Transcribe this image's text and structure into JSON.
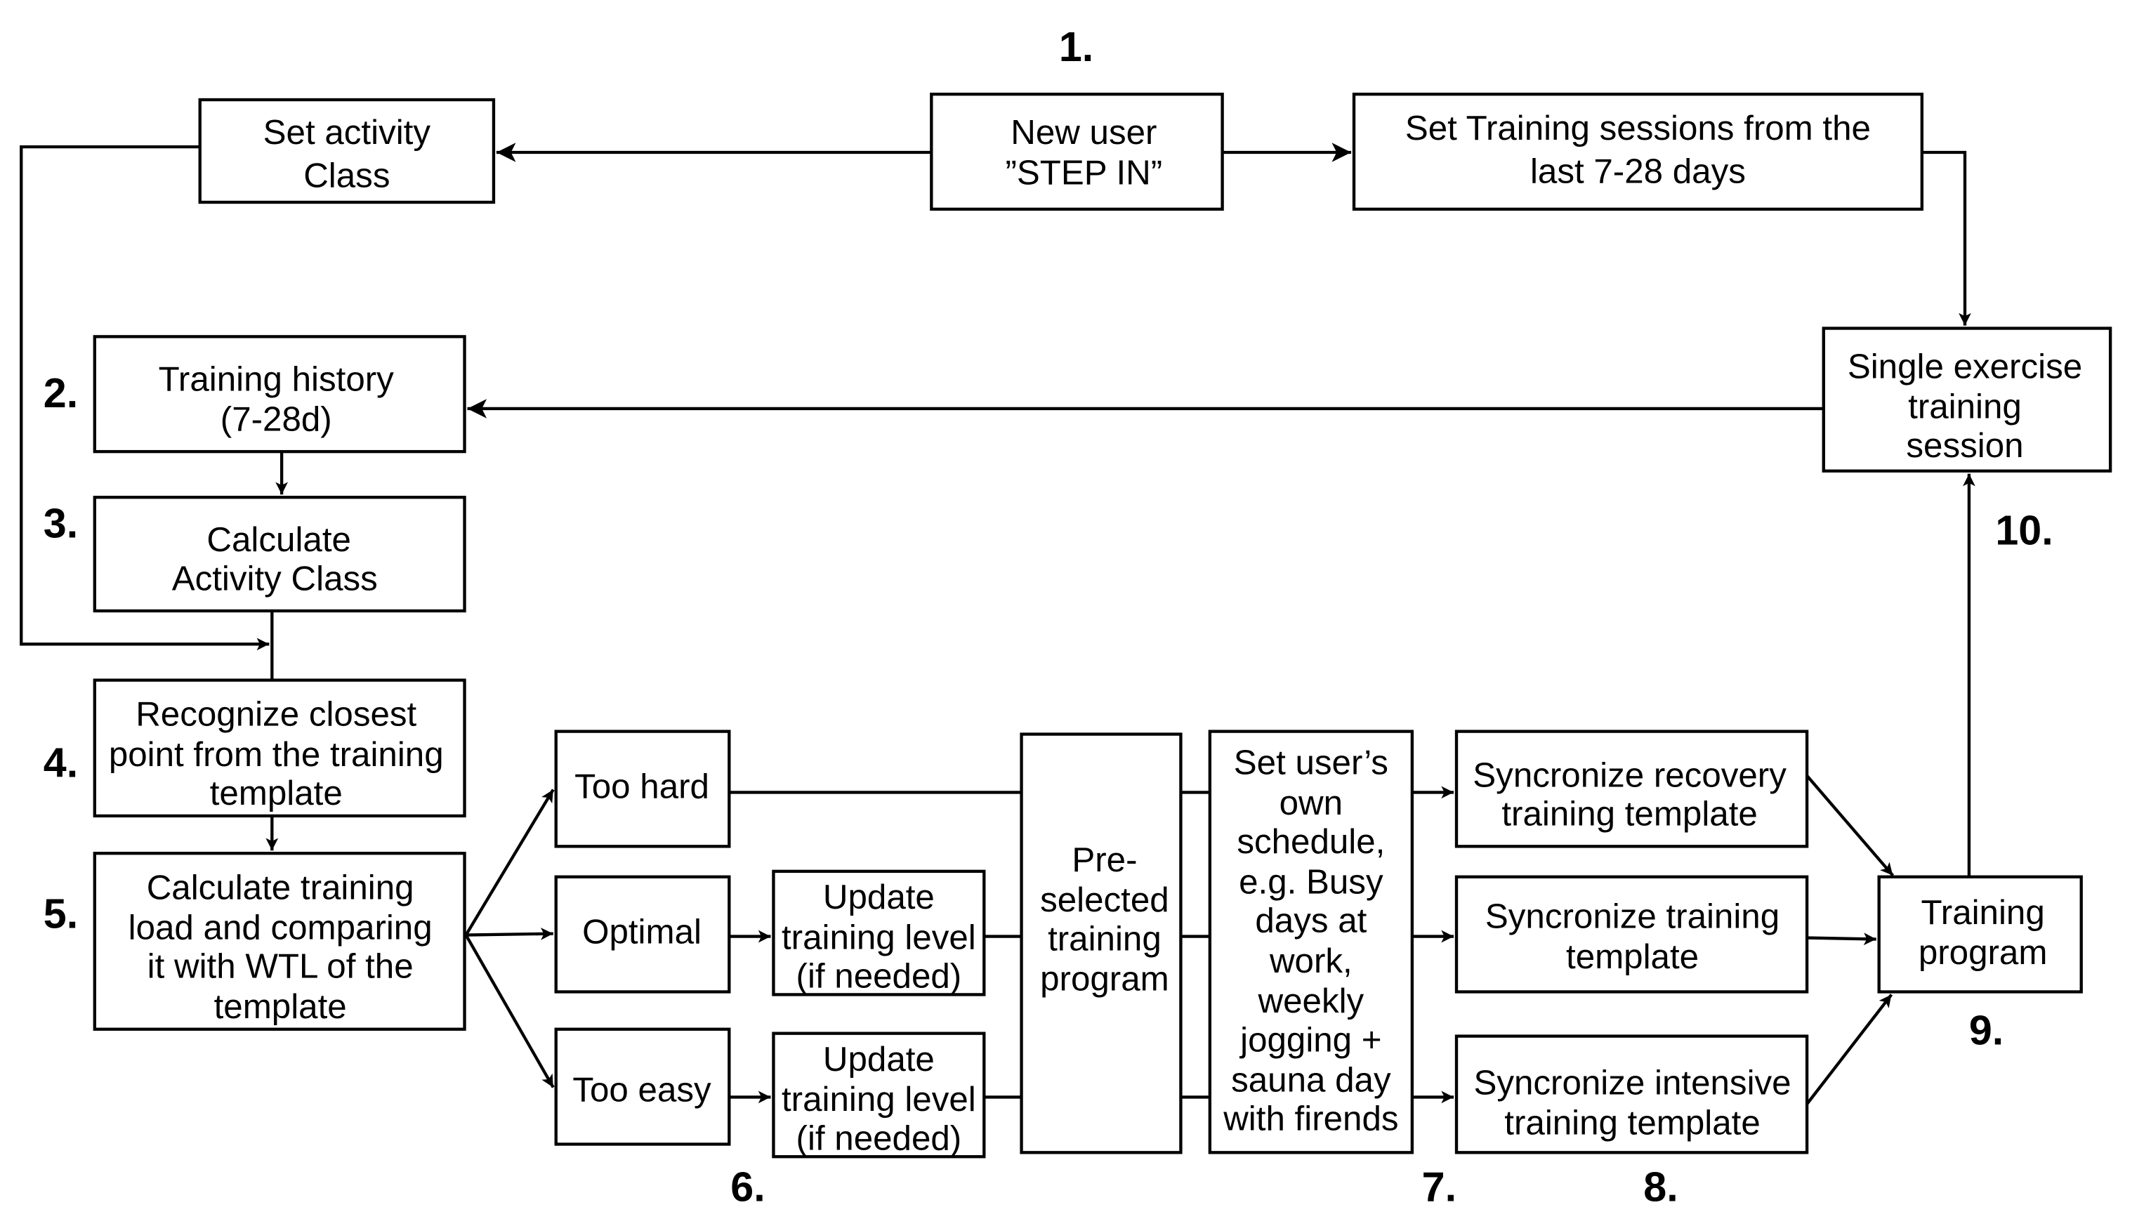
{
  "diagram": {
    "step_labels": [
      "1.",
      "2.",
      "3.",
      "4.",
      "5.",
      "6.",
      "7.",
      "8.",
      "9.",
      "10."
    ],
    "nodes": {
      "new_user": [
        "New user",
        "”STEP IN”"
      ],
      "set_activity_class": [
        "Set activity",
        "Class"
      ],
      "set_training_sessions": [
        "Set Training sessions from the",
        "last 7-28 days"
      ],
      "training_history": [
        "Training history",
        "(7-28d)"
      ],
      "calculate_activity_class": [
        "Calculate",
        "Activity Class"
      ],
      "recognize_closest_point": [
        "Recognize closest",
        "point from the training",
        "template"
      ],
      "calculate_training_load": [
        "Calculate training",
        "load and comparing",
        "it with WTL of the",
        "template"
      ],
      "too_hard": [
        "Too hard"
      ],
      "optimal": [
        "Optimal"
      ],
      "too_easy": [
        "Too easy"
      ],
      "update_level_optimal": [
        "Update",
        "training level",
        "(if needed)"
      ],
      "update_level_easy": [
        "Update",
        "training level",
        "(if needed)"
      ],
      "preselected_program": [
        "Pre-",
        "selected",
        "training",
        "program"
      ],
      "user_schedule": [
        "Set user’s",
        "own",
        "schedule,",
        "e.g. Busy",
        "days at",
        "work,",
        "weekly",
        "jogging +",
        "sauna day",
        "with firends"
      ],
      "sync_recovery": [
        "Syncronize recovery",
        "training template"
      ],
      "sync_training": [
        "Syncronize training",
        "template"
      ],
      "sync_intensive": [
        "Syncronize intensive",
        "training template"
      ],
      "training_program": [
        "Training",
        "program"
      ],
      "single_exercise_session": [
        "Single exercise",
        "training",
        "session"
      ]
    }
  }
}
